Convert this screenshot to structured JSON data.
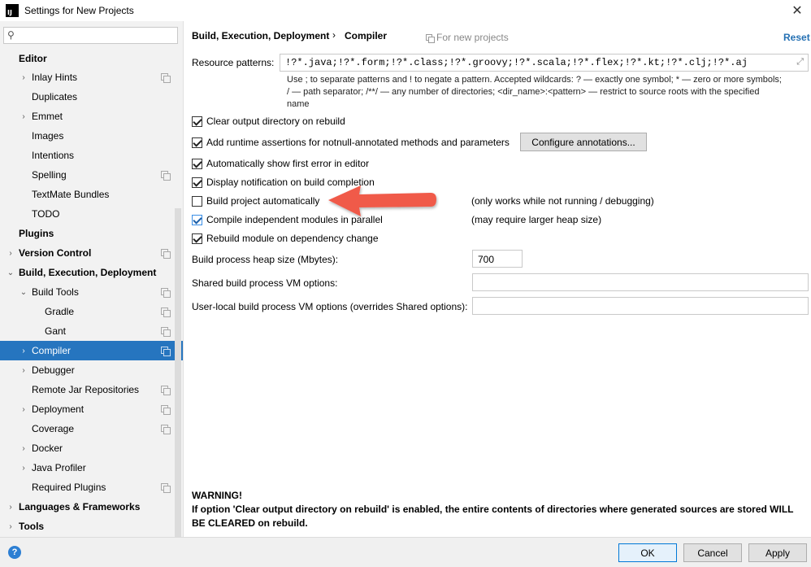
{
  "window": {
    "title": "Settings for New Projects",
    "app_icon_text": "IJ"
  },
  "search": {
    "placeholder": ""
  },
  "sidebar": {
    "items": [
      {
        "label": "Editor"
      },
      {
        "label": "Inlay Hints"
      },
      {
        "label": "Duplicates"
      },
      {
        "label": "Emmet"
      },
      {
        "label": "Images"
      },
      {
        "label": "Intentions"
      },
      {
        "label": "Spelling"
      },
      {
        "label": "TextMate Bundles"
      },
      {
        "label": "TODO"
      },
      {
        "label": "Plugins"
      },
      {
        "label": "Version Control"
      },
      {
        "label": "Build, Execution, Deployment"
      },
      {
        "label": "Build Tools"
      },
      {
        "label": "Gradle"
      },
      {
        "label": "Gant"
      },
      {
        "label": "Compiler"
      },
      {
        "label": "Debugger"
      },
      {
        "label": "Remote Jar Repositories"
      },
      {
        "label": "Deployment"
      },
      {
        "label": "Coverage"
      },
      {
        "label": "Docker"
      },
      {
        "label": "Java Profiler"
      },
      {
        "label": "Required Plugins"
      },
      {
        "label": "Languages & Frameworks"
      },
      {
        "label": "Tools"
      }
    ]
  },
  "header": {
    "breadcrumb_parent": "Build, Execution, Deployment",
    "breadcrumb_sep": "›",
    "breadcrumb_current": "Compiler",
    "scope": "For new projects",
    "reset": "Reset"
  },
  "resource_patterns": {
    "label": "Resource patterns:",
    "value": "!?*.java;!?*.form;!?*.class;!?*.groovy;!?*.scala;!?*.flex;!?*.kt;!?*.clj;!?*.aj",
    "help_line1": "Use ; to separate patterns and ! to negate a pattern. Accepted wildcards: ? — exactly one symbol; * — zero or more symbols;",
    "help_line2": "/ — path separator; /**/ — any number of directories; <dir_name>:<pattern> — restrict to source roots with the specified",
    "help_line3": "name"
  },
  "options": {
    "clear_output": {
      "label": "Clear output directory on rebuild",
      "checked": true
    },
    "runtime_assertions": {
      "label": "Add runtime assertions for notnull-annotated methods and parameters",
      "checked": true
    },
    "configure_annotations": "Configure annotations...",
    "show_first_error": {
      "label": "Automatically show first error in editor",
      "checked": true
    },
    "display_notification": {
      "label": "Display notification on build completion",
      "checked": true
    },
    "build_automatically": {
      "label": "Build project automatically",
      "checked": false,
      "note": "(only works while not running / debugging)"
    },
    "compile_parallel": {
      "label": "Compile independent modules in parallel",
      "checked": true,
      "note": "(may require larger heap size)"
    },
    "rebuild_module": {
      "label": "Rebuild module on dependency change",
      "checked": true
    }
  },
  "heap": {
    "label": "Build process heap size (Mbytes):",
    "value": "700"
  },
  "shared_vm": {
    "label": "Shared build process VM options:",
    "value": ""
  },
  "user_vm": {
    "label": "User-local build process VM options (overrides Shared options):",
    "value": ""
  },
  "warning": {
    "title": "WARNING!",
    "text": "If option 'Clear output directory on rebuild' is enabled, the entire contents of directories where generated sources are stored WILL BE CLEARED on rebuild."
  },
  "footer": {
    "help": "?",
    "ok": "OK",
    "cancel": "Cancel",
    "apply": "Apply"
  },
  "colors": {
    "selection": "#2675bf",
    "link": "#2470b3",
    "arrow": "#f05a4a"
  }
}
